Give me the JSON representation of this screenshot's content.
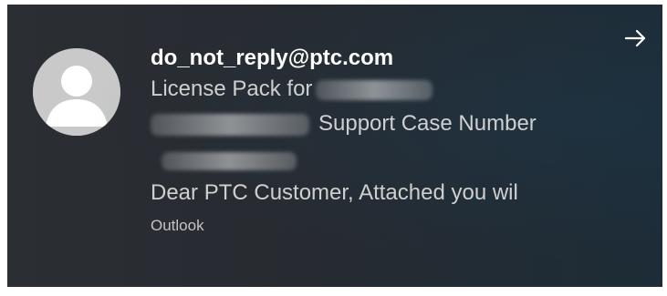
{
  "notification": {
    "sender": "do_not_reply@ptc.com",
    "subject_line1": "License Pack for",
    "subject_line2": "Support Case Number",
    "preview": "Dear PTC Customer,  Attached you wil",
    "app": "Outlook",
    "icons": {
      "avatar": "person-avatar-icon",
      "open": "arrow-right-icon"
    }
  }
}
